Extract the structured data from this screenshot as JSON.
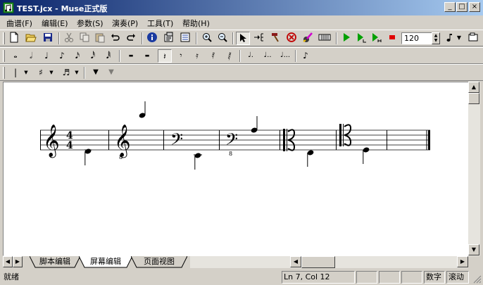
{
  "window": {
    "title": "TEST.jcx - Muse正式版",
    "buttons": {
      "minimize": "_",
      "maximize": "□",
      "close": "×"
    }
  },
  "menu": [
    {
      "label": "曲谱(F)"
    },
    {
      "label": "编辑(E)"
    },
    {
      "label": "参数(S)"
    },
    {
      "label": "演奏(P)"
    },
    {
      "label": "工具(T)"
    },
    {
      "label": "帮助(H)"
    }
  ],
  "toolbar_main": {
    "icons": [
      "new-file-icon",
      "open-folder-icon",
      "save-icon",
      "cut-icon",
      "copy-icon",
      "paste-icon",
      "undo-icon",
      "redo-icon",
      "info-icon",
      "properties-icon",
      "list-icon",
      "zoom-in-icon",
      "zoom-out-icon",
      "pointer-icon",
      "insert-icon",
      "hammer-icon",
      "stop-circle-icon",
      "pen-edit-icon",
      "keyboard-icon",
      "play-icon",
      "play-from-icon",
      "play-here-icon",
      "record-stop-icon"
    ],
    "tempo": "120",
    "tempo_spin_up": "▲",
    "tempo_spin_down": "▼"
  },
  "toolbar_notes": {
    "glyphs": {
      "whole": "𝅝",
      "half": "𝅗𝅥",
      "quarter": "♩",
      "eighth": "♪",
      "sixteenth": "𝅘𝅥𝅯",
      "thirtysecond": "𝅘𝅥𝅰",
      "sixtyfourth": "𝅘𝅥𝅱",
      "whole_rest": "▬",
      "half_rest": "▬",
      "quarter_rest": "𝄽",
      "eighth_rest": "𝄾",
      "sixteenth_rest": "𝄿",
      "thirtysecond_rest": "𝅀",
      "sixtyfourth_rest": "𝅁",
      "dot1": "♩.",
      "dot2": "♩..",
      "dot3": "♩...",
      "grace": "♪"
    }
  },
  "toolbar_misc": {
    "barline": "|",
    "sharp": "♯",
    "tuplet": "♬",
    "arrow_down": "▼"
  },
  "tabs": [
    {
      "label": "脚本编辑"
    },
    {
      "label": "屏幕编辑"
    },
    {
      "label": "页面视图"
    }
  ],
  "status": {
    "ready": "就绪",
    "position": "Ln 7, Col 12",
    "num": "数字",
    "scroll": "滚动"
  },
  "score": {
    "time_sig_top": "4",
    "time_sig_bottom": "4",
    "octave_marks": [
      "8",
      "8"
    ]
  },
  "colors": {
    "titlebar_start": "#0a246a",
    "titlebar_end": "#a6caf0",
    "play_green": "#00a000",
    "stop_red": "#e00000"
  }
}
